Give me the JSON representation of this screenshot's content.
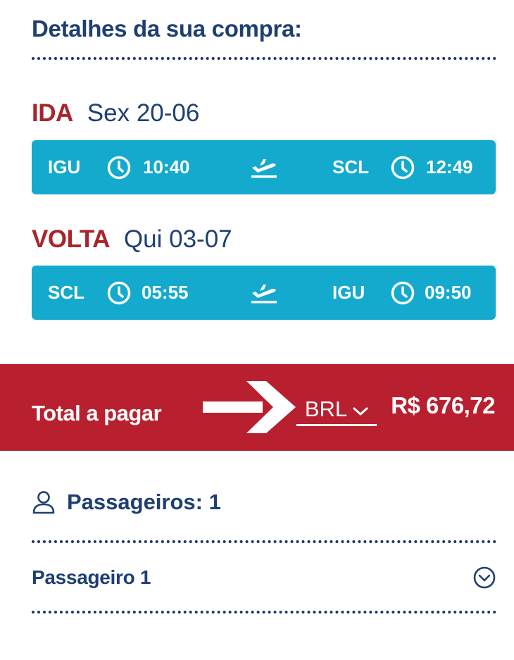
{
  "summary": {
    "title": "Detalhes da sua compra:"
  },
  "outbound": {
    "tag": "IDA",
    "date": "Sex 20-06",
    "origin": "IGU",
    "depart_time": "10:40",
    "destination": "SCL",
    "arrive_time": "12:49"
  },
  "return": {
    "tag": "VOLTA",
    "date": "Qui 03-07",
    "origin": "SCL",
    "depart_time": "05:55",
    "destination": "IGU",
    "arrive_time": "09:50"
  },
  "total": {
    "label": "Total a pagar",
    "currency": "BRL",
    "amount": "R$ 676,72"
  },
  "passengers": {
    "header": "Passageiros: 1",
    "items": [
      {
        "label": "Passageiro 1"
      }
    ]
  },
  "colors": {
    "navy": "#1e3f72",
    "red": "#b8202f",
    "tag_red": "#a8252d",
    "flight_bar": "#14aacd"
  }
}
